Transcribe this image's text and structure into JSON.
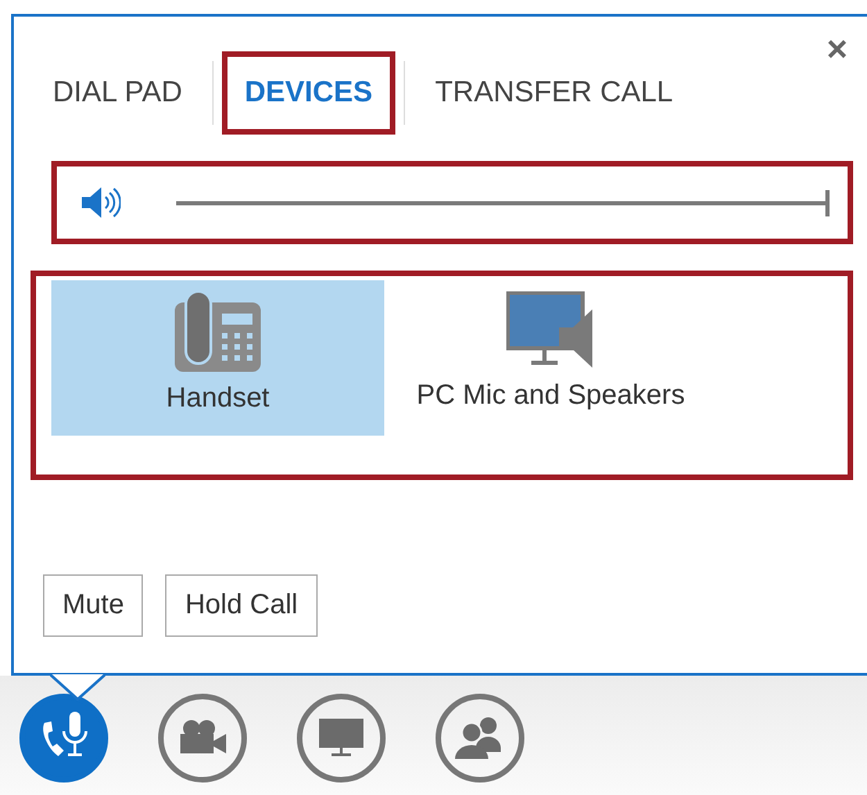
{
  "close_button": {
    "label": "×"
  },
  "tabs": [
    {
      "label": "DIAL PAD",
      "selected": false,
      "highlighted": false
    },
    {
      "label": "DEVICES",
      "selected": true,
      "highlighted": true
    },
    {
      "label": "TRANSFER CALL",
      "selected": false,
      "highlighted": false
    }
  ],
  "volume": {
    "level": 1.0,
    "highlighted": true
  },
  "devices": {
    "highlighted": true,
    "items": [
      {
        "kind": "deskphone",
        "label": "Handset",
        "selected": true
      },
      {
        "kind": "computer",
        "label": "PC Mic and Speakers",
        "selected": false
      }
    ]
  },
  "buttons": [
    {
      "label": "Mute"
    },
    {
      "label": "Hold Call"
    }
  ],
  "toolbar": [
    {
      "kind": "audio",
      "selected": true
    },
    {
      "kind": "video",
      "selected": false
    },
    {
      "kind": "screen",
      "selected": false
    },
    {
      "kind": "people",
      "selected": false
    }
  ]
}
